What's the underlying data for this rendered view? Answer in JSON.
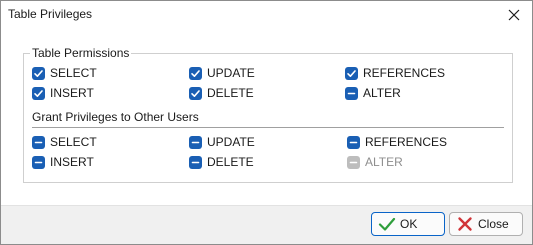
{
  "window": {
    "title": "Table Privileges"
  },
  "permissions": {
    "title": "Table Permissions",
    "items": [
      {
        "label": "SELECT",
        "state": "checked"
      },
      {
        "label": "UPDATE",
        "state": "checked"
      },
      {
        "label": "REFERENCES",
        "state": "checked"
      },
      {
        "label": "INSERT",
        "state": "checked"
      },
      {
        "label": "DELETE",
        "state": "checked"
      },
      {
        "label": "ALTER",
        "state": "indeterminate"
      }
    ]
  },
  "grant": {
    "title": "Grant Privileges to Other Users",
    "items": [
      {
        "label": "SELECT",
        "state": "indeterminate"
      },
      {
        "label": "UPDATE",
        "state": "indeterminate"
      },
      {
        "label": "REFERENCES",
        "state": "indeterminate"
      },
      {
        "label": "INSERT",
        "state": "indeterminate"
      },
      {
        "label": "DELETE",
        "state": "indeterminate"
      },
      {
        "label": "ALTER",
        "state": "disabled-indeterminate"
      }
    ]
  },
  "buttons": {
    "ok": "OK",
    "close": "Close"
  },
  "colors": {
    "accent": "#1a5fb4",
    "disabled": "#bdbdbd",
    "ok_check": "#2e9e3b",
    "close_x": "#d13438"
  }
}
